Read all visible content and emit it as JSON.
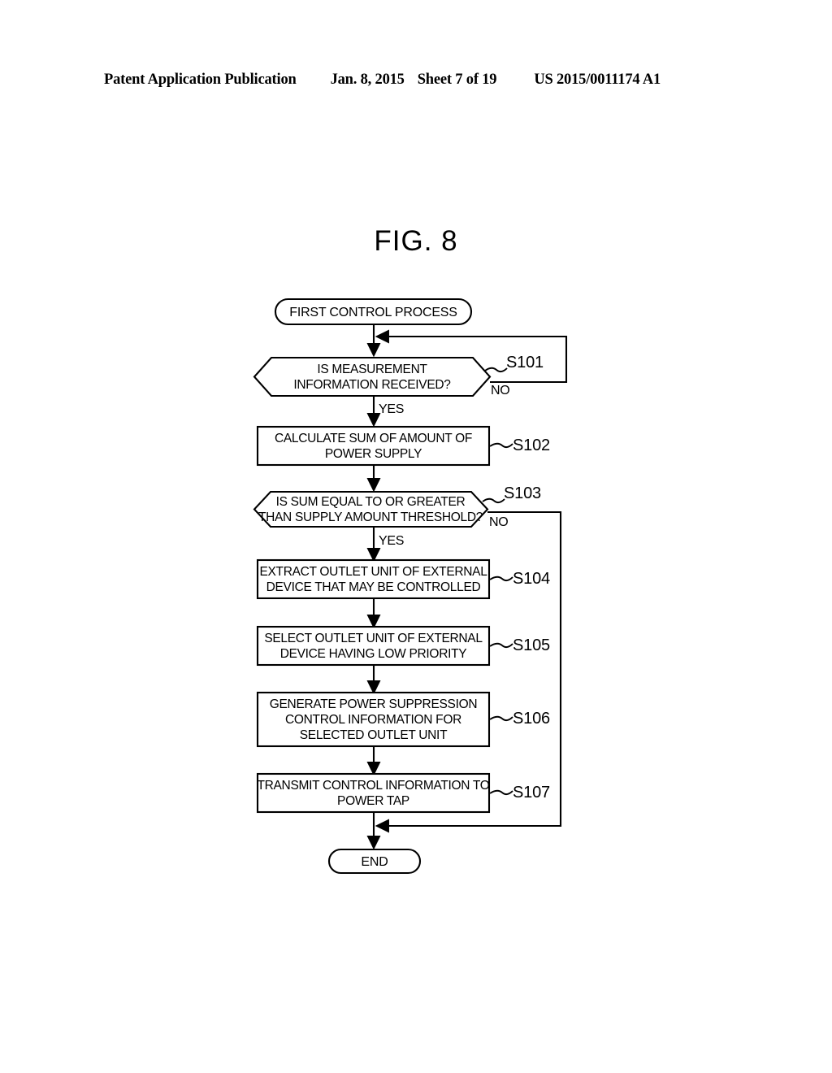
{
  "page": {
    "background_color": "#ffffff",
    "ink_color": "#000000"
  },
  "header": {
    "publication": "Patent Application Publication",
    "date": "Jan. 8, 2015",
    "sheet": "Sheet 7 of 19",
    "publication_number": "US 2015/0011174 A1"
  },
  "figure": {
    "title": "FIG. 8",
    "type": "flowchart"
  },
  "flowchart": {
    "start": {
      "label": "FIRST CONTROL PROCESS",
      "shape": "terminator"
    },
    "end": {
      "label": "END",
      "shape": "terminator"
    },
    "nodes": [
      {
        "id": "S101",
        "step": "S101",
        "shape": "decision",
        "lines": [
          "IS MEASUREMENT",
          "INFORMATION RECEIVED?"
        ],
        "yes_label": "YES",
        "no_label": "NO"
      },
      {
        "id": "S102",
        "step": "S102",
        "shape": "process",
        "lines": [
          "CALCULATE SUM OF AMOUNT OF",
          "POWER SUPPLY"
        ]
      },
      {
        "id": "S103",
        "step": "S103",
        "shape": "decision",
        "lines": [
          "IS SUM EQUAL TO OR GREATER",
          "THAN SUPPLY AMOUNT THRESHOLD?"
        ],
        "yes_label": "YES",
        "no_label": "NO"
      },
      {
        "id": "S104",
        "step": "S104",
        "shape": "process",
        "lines": [
          "EXTRACT OUTLET UNIT OF EXTERNAL",
          "DEVICE THAT MAY BE CONTROLLED"
        ]
      },
      {
        "id": "S105",
        "step": "S105",
        "shape": "process",
        "lines": [
          "SELECT OUTLET UNIT OF EXTERNAL",
          "DEVICE HAVING LOW PRIORITY"
        ]
      },
      {
        "id": "S106",
        "step": "S106",
        "shape": "process",
        "lines": [
          "GENERATE POWER SUPPRESSION",
          "CONTROL INFORMATION FOR",
          "SELECTED OUTLET UNIT"
        ]
      },
      {
        "id": "S107",
        "step": "S107",
        "shape": "process",
        "lines": [
          "TRANSMIT CONTROL INFORMATION TO",
          "POWER TAP"
        ]
      }
    ],
    "edges": [
      {
        "from": "start",
        "to": "S101",
        "label": ""
      },
      {
        "from": "S101",
        "to": "S102",
        "label": "YES"
      },
      {
        "from": "S101",
        "to": "S101",
        "label": "NO"
      },
      {
        "from": "S102",
        "to": "S103",
        "label": ""
      },
      {
        "from": "S103",
        "to": "S104",
        "label": "YES"
      },
      {
        "from": "S103",
        "to": "end",
        "label": "NO"
      },
      {
        "from": "S104",
        "to": "S105",
        "label": ""
      },
      {
        "from": "S105",
        "to": "S106",
        "label": ""
      },
      {
        "from": "S106",
        "to": "S107",
        "label": ""
      },
      {
        "from": "S107",
        "to": "end",
        "label": ""
      }
    ]
  }
}
